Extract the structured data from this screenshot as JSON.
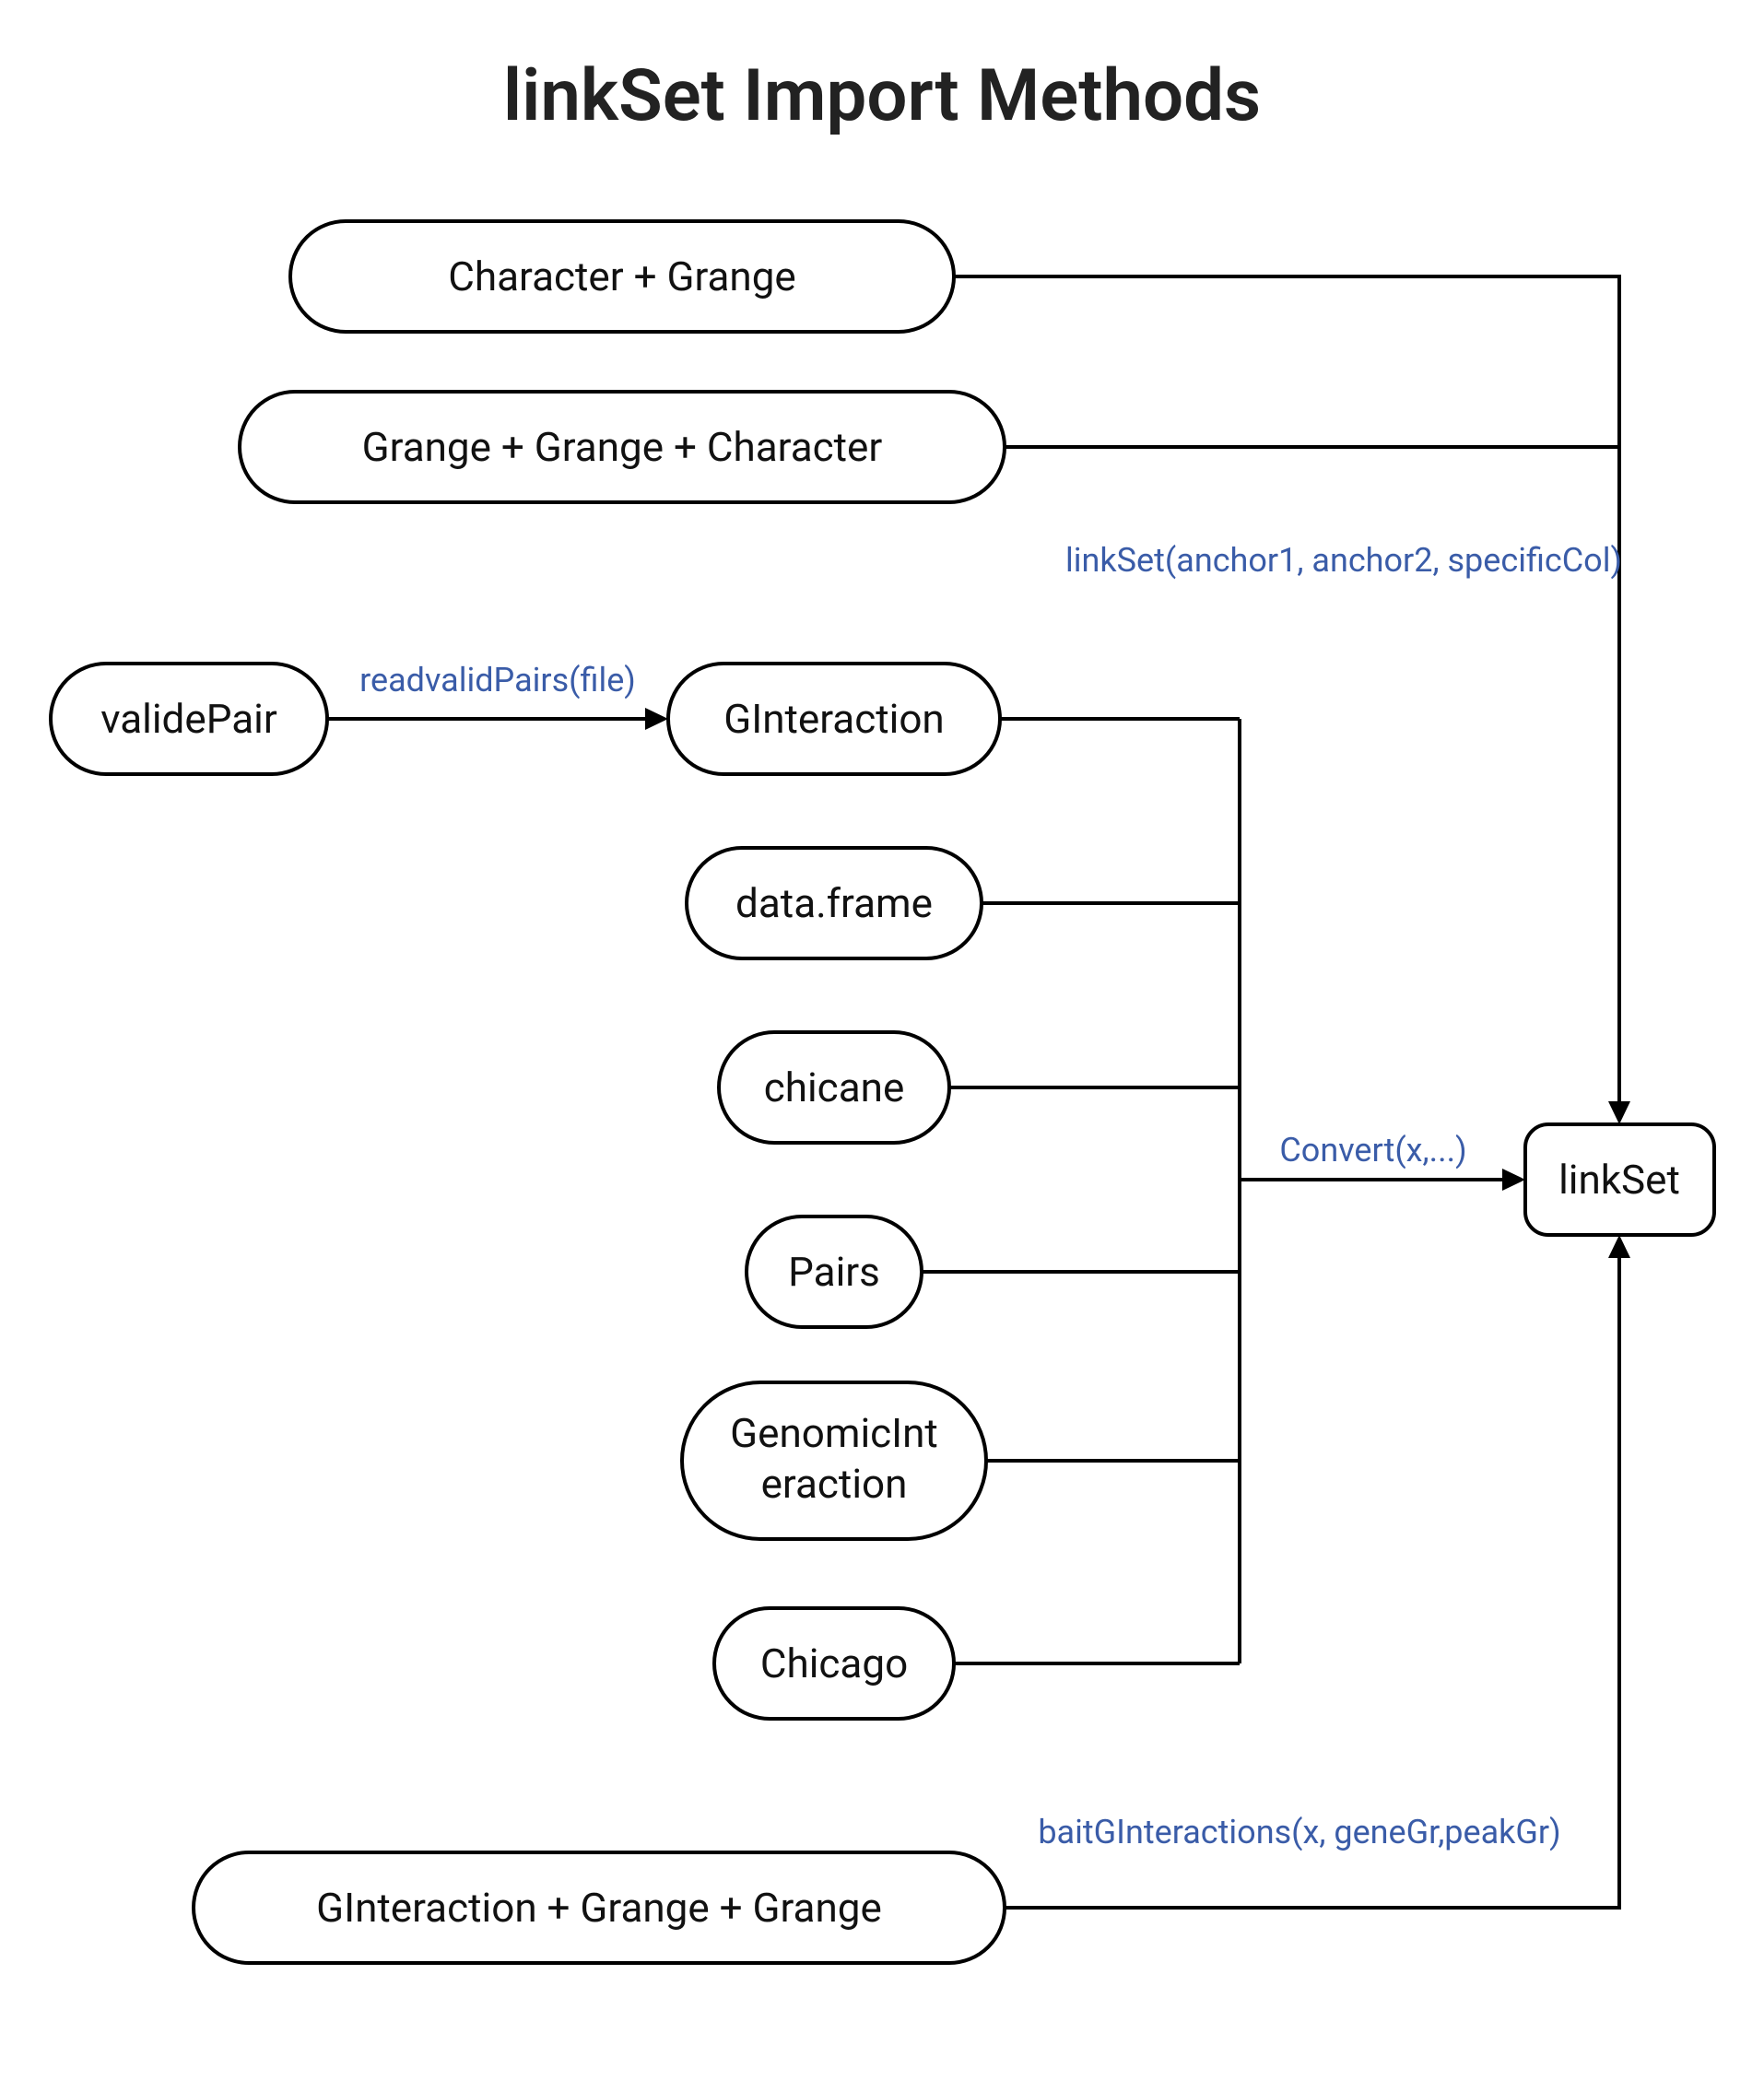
{
  "title": "linkSet Import Methods",
  "nodes": {
    "char_grange": "Character + Grange",
    "grange_grange_char": "Grange + Grange + Character",
    "validePair": "validePair",
    "gInteraction": "GInteraction",
    "dataFrame": "data.frame",
    "chicane": "chicane",
    "pairs": "Pairs",
    "genomicInteraction_l1": "GenomicInt",
    "genomicInteraction_l2": "eraction",
    "chicago": "Chicago",
    "gigg": "GInteraction + Grange + Grange",
    "linkSet": "linkSet"
  },
  "edges": {
    "readvalidPairs": "readvalidPairs(file)",
    "linkSetCall": "linkSet(anchor1, anchor2, specificCol)",
    "convert": "Convert(x,...)",
    "baitGI": "baitGInteractions(x, geneGr,peakGr)"
  },
  "colors": {
    "edgeLabel": "#3a5ca8",
    "stroke": "#000000"
  }
}
